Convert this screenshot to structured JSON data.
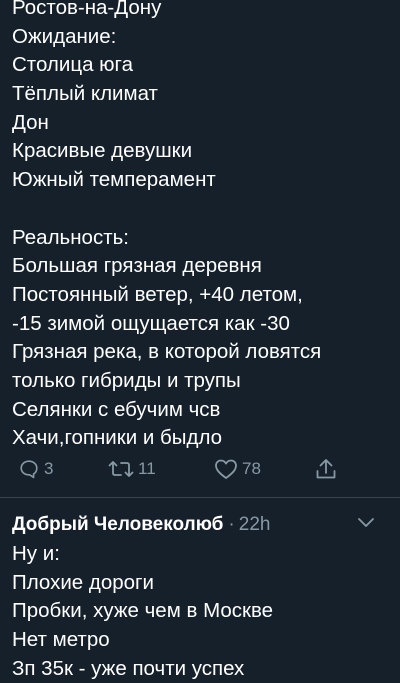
{
  "tweet": {
    "lines_part1": [
      "Ростов-на-Дону",
      "Ожидание:",
      "Столица юга",
      "Тёплый климат",
      "Дон",
      "Красивые девушки",
      "Южный темперамент"
    ],
    "lines_part2": [
      "Реальность:",
      "Большая грязная деревня",
      "Постоянный ветер, +40 летом,",
      "-15 зимой ощущается как -30",
      "Грязная река, в которой ловятся",
      "только гибриды и трупы",
      "Селянки с ебучим чсв",
      "Хачи,гопники и быдло"
    ],
    "actions": {
      "reply_count": "3",
      "retweet_count": "11",
      "like_count": "78",
      "reply_icon": "reply-bubble-icon",
      "retweet_icon": "retweet-icon",
      "like_icon": "heart-icon",
      "share_icon": "share-icon"
    }
  },
  "reply": {
    "author_name": "Добрый Человеколюб",
    "separator": "·",
    "timestamp": "22h",
    "menu_icon": "chevron-down-icon",
    "lines": [
      "Ну и:",
      "Плохие дороги",
      "Пробки, хуже чем в Москве",
      "Нет метро",
      "Зп 35к - уже почти успех"
    ]
  },
  "colors": {
    "background": "#15202b",
    "text": "#ffffff",
    "secondary": "#8899a6",
    "divider": "#38444d"
  }
}
